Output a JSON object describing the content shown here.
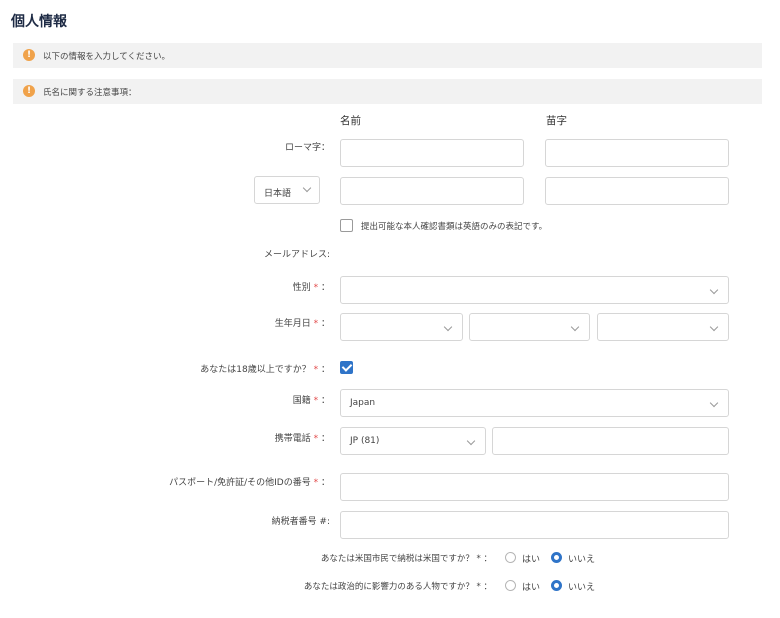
{
  "page": {
    "title": "個人情報"
  },
  "notices": {
    "info": "以下の情報を入力してください。",
    "name_note": "氏名に関する注意事項："
  },
  "columns": {
    "first_name": "名前",
    "last_name": "苗字"
  },
  "form": {
    "romaji_label": "ローマ字：",
    "language_select": "日本語",
    "english_only_checkbox": {
      "label": "提出可能な本人確認書類は英語のみの表記です。",
      "checked": false
    },
    "email_label": "メールアドレス:",
    "gender_label": "性別",
    "birthdate_label": "生年月日",
    "adult_label": "あなたは18歳以上ですか？",
    "adult_checked": true,
    "nationality_label": "国籍",
    "nationality_value": "Japan",
    "phone_label": "携帯電話",
    "phone_code_value": "JP (81)",
    "id_number_label": "パスポート/免許証/その他IDの番号",
    "tax_number_label": "納税者番号 #:",
    "us_citizen_label": "あなたは米国市民で納税は米国ですか？",
    "pep_label": "あなたは政治的に影響力のある人物ですか？",
    "required_mark": "*",
    "colon": "：",
    "radio_yes": "はい",
    "radio_no": "いいえ",
    "us_citizen_selected": "いいえ",
    "pep_selected": "いいえ"
  },
  "colors": {
    "accent": "#2f74c8",
    "required": "#e24a4a",
    "warning": "#f0a24a"
  },
  "icons": {
    "notice": "exclamation-circle-icon",
    "dropdown": "chevron-down-icon"
  }
}
